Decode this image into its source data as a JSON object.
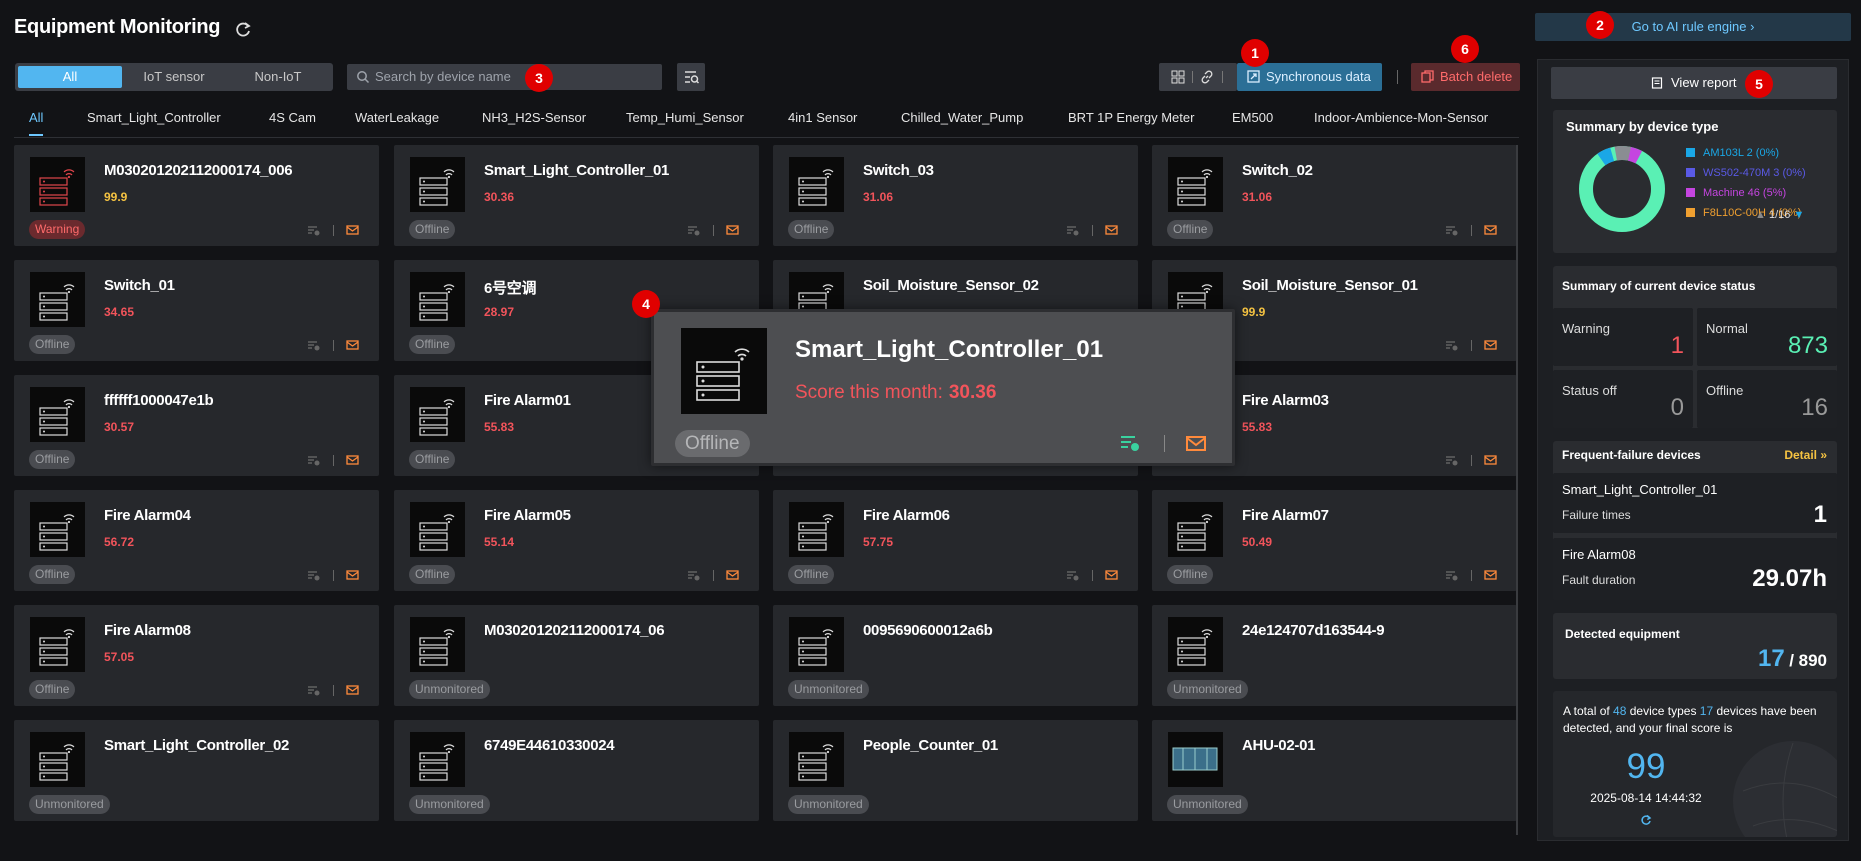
{
  "header": {
    "title": "Equipment Monitoring",
    "ai_rule_label": "Go to AI rule engine ›"
  },
  "toolbar": {
    "segments": [
      "All",
      "IoT sensor",
      "Non-IoT"
    ],
    "search_placeholder": "Search by device name",
    "sync_label": "Synchronous data",
    "batch_delete_label": "Batch delete"
  },
  "tabs": [
    "All",
    "Smart_Light_Controller",
    "4S Cam",
    "WaterLeakage",
    "NH3_H2S-Sensor",
    "Temp_Humi_Sensor",
    "4in1 Sensor",
    "Chilled_Water_Pump",
    "BRT 1P Energy Meter",
    "EM500",
    "Indoor-Ambience-Mon-Sensor"
  ],
  "devices": [
    {
      "name": "M030201202112000174_006",
      "score": "99.9",
      "status": "Warning",
      "color": "#f5c342"
    },
    {
      "name": "Smart_Light_Controller_01",
      "score": "30.36",
      "status": "Offline",
      "color": "#f2545b"
    },
    {
      "name": "Switch_03",
      "score": "31.06",
      "status": "Offline",
      "color": "#f2545b"
    },
    {
      "name": "Switch_02",
      "score": "31.06",
      "status": "Offline",
      "color": "#f2545b"
    },
    {
      "name": "Switch_01",
      "score": "34.65",
      "status": "Offline",
      "color": "#f2545b"
    },
    {
      "name": "6号空调",
      "score": "28.97",
      "status": "Offline",
      "color": "#f2545b"
    },
    {
      "name": "Soil_Moisture_Sensor_02",
      "score": "",
      "status": "",
      "color": "#f2545b"
    },
    {
      "name": "Soil_Moisture_Sensor_01",
      "score": "99.9",
      "status": "",
      "color": "#f5c342"
    },
    {
      "name": "ffffff1000047e1b",
      "score": "30.57",
      "status": "Offline",
      "color": "#f2545b"
    },
    {
      "name": "Fire Alarm01",
      "score": "55.83",
      "status": "Offline",
      "color": "#f2545b"
    },
    {
      "name": "",
      "score": "",
      "status": "",
      "color": "#f2545b"
    },
    {
      "name": "Fire Alarm03",
      "score": "55.83",
      "status": "",
      "color": "#f2545b"
    },
    {
      "name": "Fire Alarm04",
      "score": "56.72",
      "status": "Offline",
      "color": "#f2545b"
    },
    {
      "name": "Fire Alarm05",
      "score": "55.14",
      "status": "Offline",
      "color": "#f2545b"
    },
    {
      "name": "Fire Alarm06",
      "score": "57.75",
      "status": "Offline",
      "color": "#f2545b"
    },
    {
      "name": "Fire Alarm07",
      "score": "50.49",
      "status": "Offline",
      "color": "#f2545b"
    },
    {
      "name": "Fire Alarm08",
      "score": "57.05",
      "status": "Offline",
      "color": "#f2545b"
    },
    {
      "name": "M030201202112000174_06",
      "score": "",
      "status": "Unmonitored",
      "color": "#f2545b"
    },
    {
      "name": "0095690600012a6b",
      "score": "",
      "status": "Unmonitored",
      "color": "#f2545b"
    },
    {
      "name": "24e124707d163544-9",
      "score": "",
      "status": "Unmonitored",
      "color": "#f2545b"
    },
    {
      "name": "Smart_Light_Controller_02",
      "score": "",
      "status": "Unmonitored",
      "color": "#f2545b"
    },
    {
      "name": "6749E44610330024",
      "score": "",
      "status": "Unmonitored",
      "color": "#f2545b"
    },
    {
      "name": "People_Counter_01",
      "score": "",
      "status": "Unmonitored",
      "color": "#f2545b"
    },
    {
      "name": "AHU-02-01",
      "score": "",
      "status": "Unmonitored",
      "color": "#f2545b"
    }
  ],
  "popup": {
    "name": "Smart_Light_Controller_01",
    "score_label": "Score this month:",
    "score": "30.36",
    "status": "Offline"
  },
  "sidebar": {
    "view_report": "View report",
    "type_summary": {
      "title": "Summary by device type",
      "legend": [
        {
          "label": "AM103L 2 (0%)",
          "color": "#1aa7e6"
        },
        {
          "label": "WS502-470M 3 (0%)",
          "color": "#5a5ae6"
        },
        {
          "label": "Machine 46 (5%)",
          "color": "#c545e0"
        },
        {
          "label": "F8L10C-00H 4 (0%)",
          "color": "#f0a030"
        }
      ],
      "pager": "1/16"
    },
    "status_summary": {
      "title": "Summary of current device status",
      "warning_label": "Warning",
      "warning": "1",
      "normal_label": "Normal",
      "normal": "873",
      "off_label": "Status off",
      "off": "0",
      "offline_label": "Offline",
      "offline": "16"
    },
    "failure": {
      "title": "Frequent-failure devices",
      "detail": "Detail »",
      "d1_name": "Smart_Light_Controller_01",
      "d1_label": "Failure times",
      "d1_value": "1",
      "d2_name": "Fire Alarm08",
      "d2_label": "Fault duration",
      "d2_value": "29.07h"
    },
    "detected": {
      "title": "Detected equipment",
      "count": "17",
      "total": "/ 890"
    },
    "final": {
      "t1": "A total of ",
      "types": "48",
      "t2": " device types ",
      "devices": "17",
      "t3": " devices have been detected, and your final score is",
      "score": "99",
      "datetime": "2025-08-14 14:44:32"
    }
  },
  "markers": [
    "1",
    "2",
    "3",
    "4",
    "5",
    "6"
  ]
}
